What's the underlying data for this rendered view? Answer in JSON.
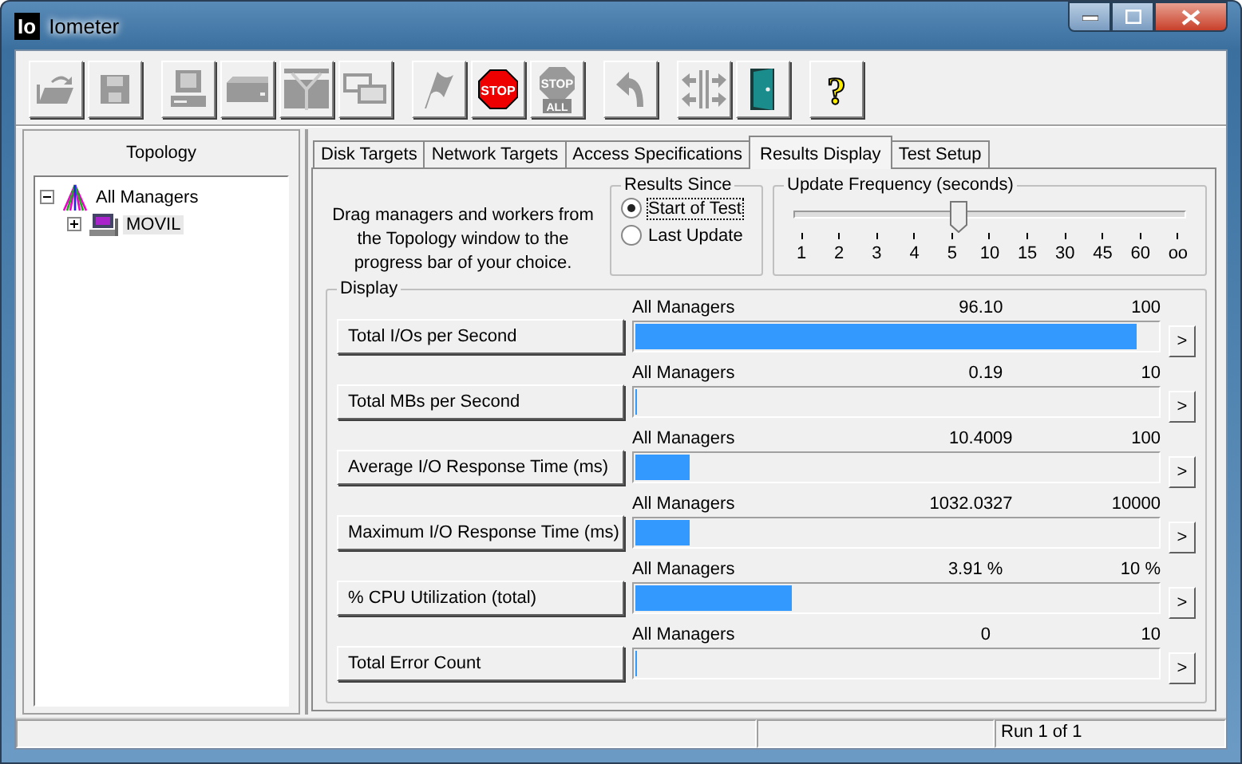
{
  "window": {
    "icon_text": "Io",
    "title": "Iometer"
  },
  "toolbar": [
    [
      {
        "kind": "open",
        "disabled": true
      },
      {
        "kind": "save",
        "disabled": true
      }
    ],
    [
      {
        "kind": "computer",
        "disabled": true
      },
      {
        "kind": "disk",
        "disabled": true
      },
      {
        "kind": "network",
        "disabled": true
      },
      {
        "kind": "copy",
        "disabled": true
      }
    ],
    [
      {
        "kind": "start",
        "disabled": true
      },
      {
        "kind": "stop",
        "disabled": false,
        "label": "STOP"
      },
      {
        "kind": "stopall",
        "disabled": true,
        "label": "STOP",
        "sublabel": "ALL"
      }
    ],
    [
      {
        "kind": "reset",
        "disabled": true
      }
    ],
    [
      {
        "kind": "split",
        "disabled": true
      },
      {
        "kind": "exit",
        "disabled": false
      }
    ],
    [
      {
        "kind": "help",
        "disabled": false,
        "label": "?"
      }
    ]
  ],
  "topology": {
    "title": "Topology",
    "tree": [
      {
        "label": "All Managers",
        "expanded": true,
        "kind": "managers",
        "children": [
          {
            "label": "MOVIL",
            "expanded": false,
            "kind": "computer",
            "selected": true
          }
        ]
      }
    ]
  },
  "tabs": [
    {
      "label": "Disk Targets",
      "selected": false
    },
    {
      "label": "Network Targets",
      "selected": false
    },
    {
      "label": "Access Specifications",
      "selected": false
    },
    {
      "label": "Results Display",
      "selected": true
    },
    {
      "label": "Test Setup",
      "selected": false
    }
  ],
  "instructions": "Drag managers and workers from the Topology window to the progress bar of your choice.",
  "results_since": {
    "title": "Results Since",
    "options": [
      {
        "label": "Start of Test",
        "selected": true
      },
      {
        "label": "Last Update",
        "selected": false
      }
    ]
  },
  "update_frequency": {
    "title": "Update Frequency (seconds)",
    "level": 0.4,
    "ticks": [
      "1",
      "2",
      "3",
      "4",
      "5",
      "10",
      "15",
      "30",
      "45",
      "60",
      "oo"
    ]
  },
  "display": {
    "title": "Display",
    "rows": [
      {
        "metric": "Total I/Os per Second",
        "source": "All Managers",
        "value": "96.10",
        "max": "100",
        "level": 0.961,
        "button": ">"
      },
      {
        "metric": "Total MBs per Second",
        "source": "All Managers",
        "value": "0.19",
        "max": "10",
        "level": 0,
        "button": ">"
      },
      {
        "metric": "Average I/O Response Time (ms)",
        "source": "All Managers",
        "value": "10.4009",
        "max": "100",
        "level": 0.104,
        "button": ">"
      },
      {
        "metric": "Maximum I/O Response Time (ms)",
        "source": "All Managers",
        "value": "1032.0327",
        "max": "10000",
        "level": 0.103,
        "button": ">"
      },
      {
        "metric": "% CPU Utilization (total)",
        "source": "All Managers",
        "value": "3.91 %",
        "max": "10 %",
        "level": 0.3,
        "button": ">"
      },
      {
        "metric": "Total Error Count",
        "source": "All Managers",
        "value": "0",
        "max": "10",
        "level": 0,
        "button": ">"
      }
    ]
  },
  "status_bar": {
    "run": "Run 1 of 1"
  }
}
